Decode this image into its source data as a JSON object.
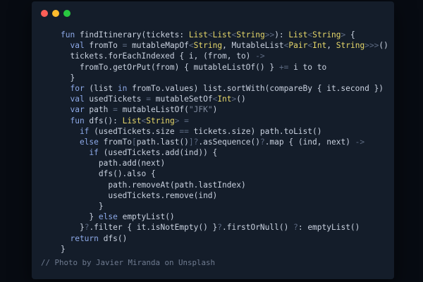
{
  "colors": {
    "background": "#070b12",
    "window": "#141d2a",
    "close": "#ff5f57",
    "minimize": "#febc2e",
    "maximize": "#28c840",
    "keyword": "#8da9e8",
    "type": "#e6d76a",
    "operator": "#5d6a82",
    "string": "#7f8a9e",
    "caption": "#6f7b90"
  },
  "window_controls": {
    "close_icon": "red-circle",
    "minimize_icon": "yellow-circle",
    "maximize_icon": "green-circle"
  },
  "code_lines": [
    [
      [
        "kw",
        "fun "
      ],
      [
        "plain",
        "findItinerary(tickets: "
      ],
      [
        "type",
        "List"
      ],
      [
        "op",
        "<"
      ],
      [
        "type",
        "List"
      ],
      [
        "op",
        "<"
      ],
      [
        "type",
        "String"
      ],
      [
        "op",
        ">>"
      ],
      [
        "plain",
        "): "
      ],
      [
        "type",
        "List"
      ],
      [
        "op",
        "<"
      ],
      [
        "type",
        "String"
      ],
      [
        "op",
        ">"
      ],
      [
        "plain",
        " {"
      ]
    ],
    [
      [
        "kw",
        "  val "
      ],
      [
        "plain",
        "fromTo "
      ],
      [
        "op",
        "= "
      ],
      [
        "plain",
        "mutableMapOf"
      ],
      [
        "op",
        "<"
      ],
      [
        "type",
        "String"
      ],
      [
        "plain",
        ", MutableList"
      ],
      [
        "op",
        "<"
      ],
      [
        "type",
        "Pair"
      ],
      [
        "op",
        "<"
      ],
      [
        "type",
        "Int"
      ],
      [
        "plain",
        ", "
      ],
      [
        "type",
        "String"
      ],
      [
        "op",
        ">>>"
      ],
      [
        "plain",
        "()"
      ]
    ],
    [
      [
        "plain",
        "  tickets.forEachIndexed { i, (from, to) "
      ],
      [
        "op",
        "->"
      ]
    ],
    [
      [
        "plain",
        "    fromTo.getOrPut(from) { mutableListOf() } "
      ],
      [
        "op",
        "+= "
      ],
      [
        "plain",
        "i to to"
      ]
    ],
    [
      [
        "plain",
        "  }"
      ]
    ],
    [
      [
        "kw",
        "  for "
      ],
      [
        "plain",
        "(list "
      ],
      [
        "kw",
        "in "
      ],
      [
        "plain",
        "fromTo.values) list.sortWith(compareBy { it.second })"
      ]
    ],
    [
      [
        "kw",
        "  val "
      ],
      [
        "plain",
        "usedTickets "
      ],
      [
        "op",
        "= "
      ],
      [
        "plain",
        "mutableSetOf"
      ],
      [
        "op",
        "<"
      ],
      [
        "type",
        "Int"
      ],
      [
        "op",
        ">"
      ],
      [
        "plain",
        "()"
      ]
    ],
    [
      [
        "kw",
        "  var "
      ],
      [
        "plain",
        "path "
      ],
      [
        "op",
        "= "
      ],
      [
        "plain",
        "mutableListOf("
      ],
      [
        "str",
        "\"JFK\""
      ],
      [
        "plain",
        ")"
      ]
    ],
    [
      [
        "kw",
        "  fun "
      ],
      [
        "plain",
        "dfs(): "
      ],
      [
        "type",
        "List"
      ],
      [
        "op",
        "<"
      ],
      [
        "type",
        "String"
      ],
      [
        "op",
        "> ="
      ]
    ],
    [
      [
        "kw",
        "    if "
      ],
      [
        "plain",
        "(usedTickets.size "
      ],
      [
        "op",
        "== "
      ],
      [
        "plain",
        "tickets.size) path.toList()"
      ]
    ],
    [
      [
        "kw",
        "    else "
      ],
      [
        "plain",
        "fromTo"
      ],
      [
        "op",
        "["
      ],
      [
        "plain",
        "path.last()"
      ],
      [
        "op",
        "]?"
      ],
      [
        "plain",
        ".asSequence()"
      ],
      [
        "op",
        "?"
      ],
      [
        "plain",
        ".map { (ind, next) "
      ],
      [
        "op",
        "->"
      ]
    ],
    [
      [
        "kw",
        "      if "
      ],
      [
        "plain",
        "(usedTickets.add(ind)) {"
      ]
    ],
    [
      [
        "plain",
        "        path.add(next)"
      ]
    ],
    [
      [
        "plain",
        "        dfs().also {"
      ]
    ],
    [
      [
        "plain",
        "          path.removeAt(path.lastIndex)"
      ]
    ],
    [
      [
        "plain",
        "          usedTickets.remove(ind)"
      ]
    ],
    [
      [
        "plain",
        "        }"
      ]
    ],
    [
      [
        "plain",
        "      } "
      ],
      [
        "kw",
        "else "
      ],
      [
        "plain",
        "emptyList()"
      ]
    ],
    [
      [
        "plain",
        "    }"
      ],
      [
        "op",
        "?"
      ],
      [
        "plain",
        ".filter { it.isNotEmpty() }"
      ],
      [
        "op",
        "?"
      ],
      [
        "plain",
        ".firstOrNull() "
      ],
      [
        "op",
        "?"
      ],
      [
        "plain",
        ": emptyList()"
      ]
    ],
    [
      [
        "kw",
        "  return "
      ],
      [
        "plain",
        "dfs()"
      ]
    ],
    [
      [
        "plain",
        "}"
      ]
    ]
  ],
  "caption": "// Photo by Javier Miranda on Unsplash"
}
